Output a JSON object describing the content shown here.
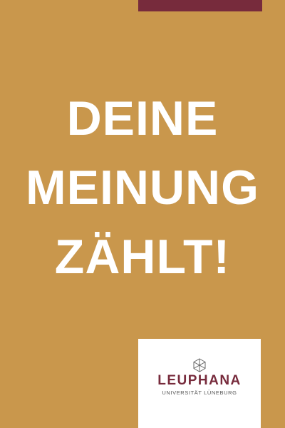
{
  "colors": {
    "background": "#C9974C",
    "accent_bar": "#772B3C",
    "headline": "#FFFFFF",
    "logo": "#772B3C"
  },
  "headline": {
    "lines": [
      "DEINE",
      "MEINUNG",
      "ZÄHLT!"
    ]
  },
  "logo": {
    "name": "LEUPHANA",
    "subtitle": "UNIVERSITÄT LÜNEBURG",
    "icon": "hexagon-cube-icon"
  }
}
